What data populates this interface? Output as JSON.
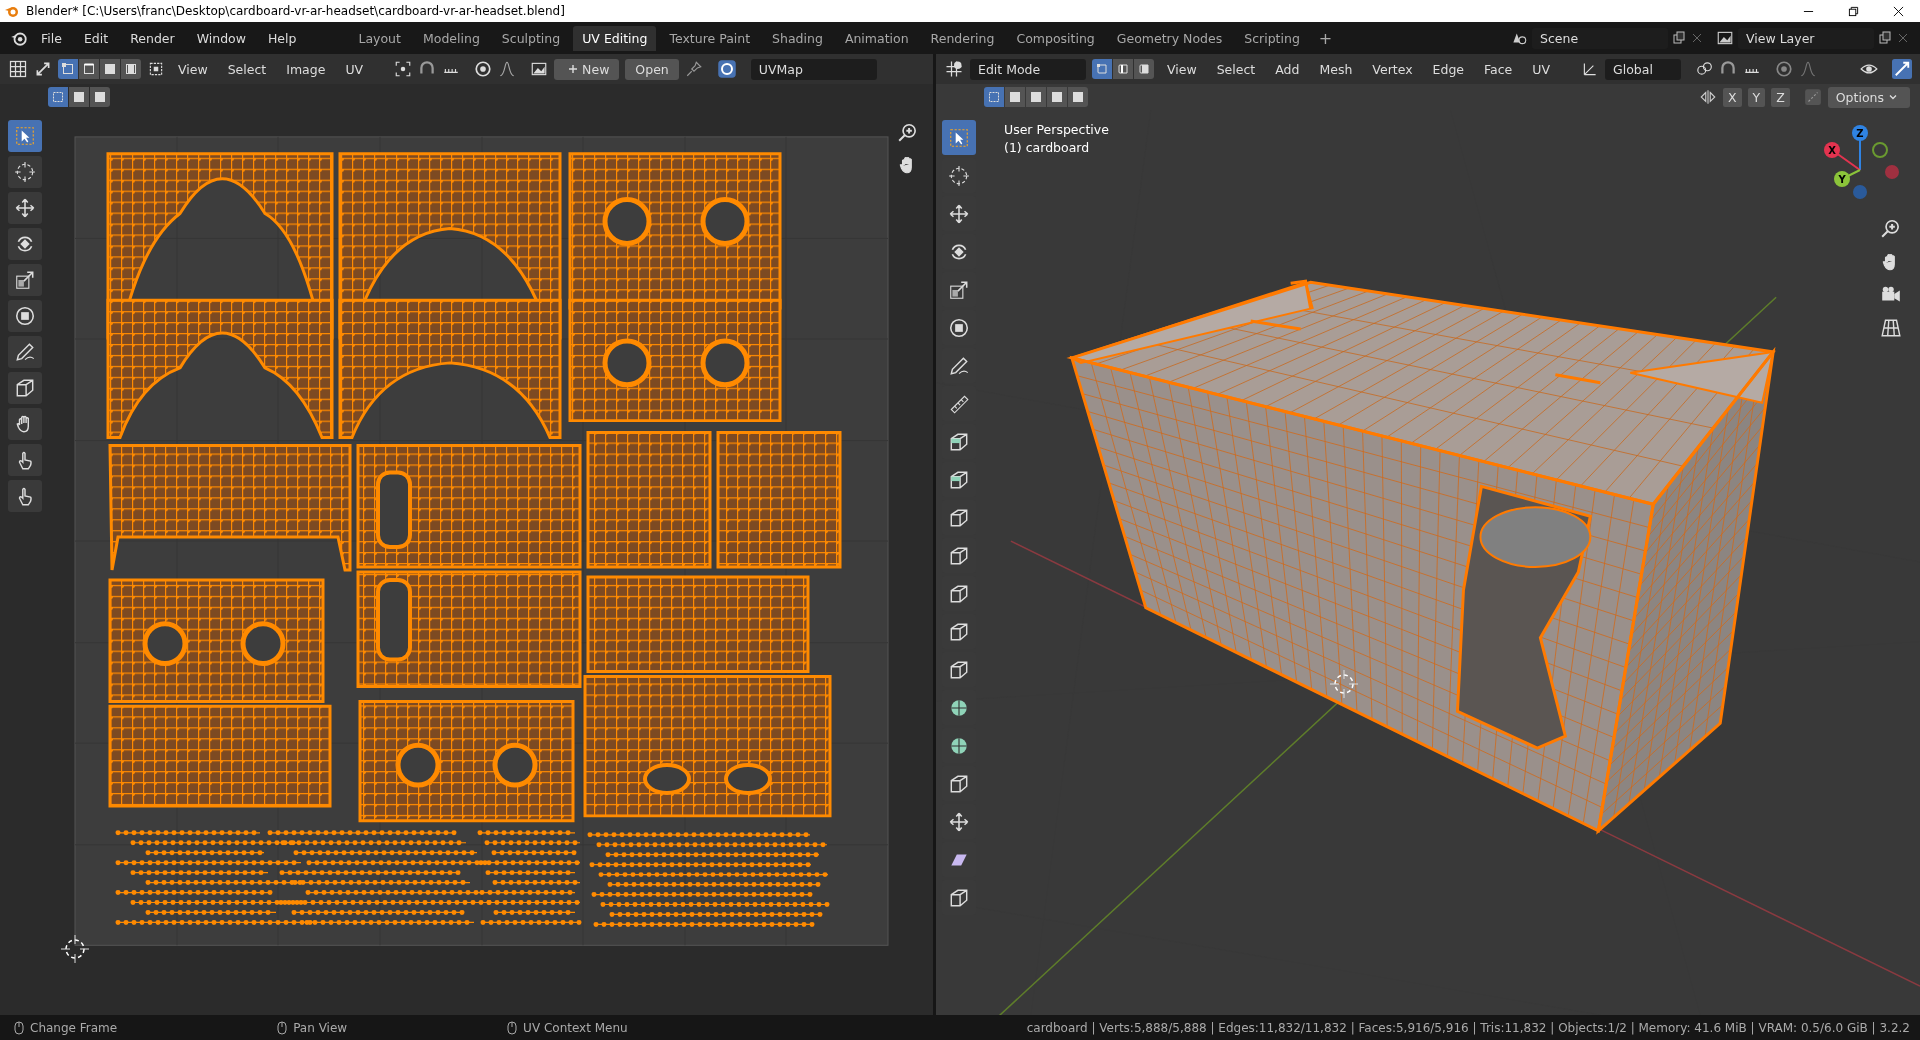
{
  "window": {
    "title": "Blender* [C:\\Users\\franc\\Desktop\\cardboard-vr-ar-headset\\cardboard-vr-ar-headset.blend]"
  },
  "menu": [
    "File",
    "Edit",
    "Render",
    "Window",
    "Help"
  ],
  "workspaces": [
    {
      "label": "Layout",
      "selected": false
    },
    {
      "label": "Modeling",
      "selected": false
    },
    {
      "label": "Sculpting",
      "selected": false
    },
    {
      "label": "UV Editing",
      "selected": true
    },
    {
      "label": "Texture Paint",
      "selected": false
    },
    {
      "label": "Shading",
      "selected": false
    },
    {
      "label": "Animation",
      "selected": false
    },
    {
      "label": "Rendering",
      "selected": false
    },
    {
      "label": "Compositing",
      "selected": false
    },
    {
      "label": "Geometry Nodes",
      "selected": false
    },
    {
      "label": "Scripting",
      "selected": false
    }
  ],
  "add_workspace": "+",
  "scene": {
    "value": "Scene"
  },
  "view_layer": {
    "value": "View Layer"
  },
  "uv_editor": {
    "select_modes": [
      {
        "selected": true
      },
      {
        "selected": false
      },
      {
        "selected": false
      },
      {
        "selected": false
      }
    ],
    "menus": [
      "View",
      "Select",
      "Image",
      "UV"
    ],
    "new_button": "New",
    "open_button": "Open",
    "uv_map": "UVMap",
    "box_modes": [
      {
        "selected": true
      },
      {
        "selected": false
      },
      {
        "selected": false
      }
    ],
    "tools": [
      {
        "kind": "select",
        "selected": true
      },
      {
        "kind": "cursor",
        "selected": false
      },
      {
        "kind": "move",
        "selected": false
      },
      {
        "kind": "rotate",
        "selected": false
      },
      {
        "kind": "scale",
        "selected": false
      },
      {
        "kind": "transform",
        "selected": false
      },
      {
        "kind": "annotate",
        "selected": false
      },
      {
        "kind": "rip",
        "selected": false
      },
      {
        "kind": "grab",
        "selected": false
      },
      {
        "kind": "relax",
        "selected": false
      },
      {
        "kind": "pinch",
        "selected": false
      }
    ]
  },
  "viewport": {
    "mode": "Edit Mode",
    "select_modes": [
      {
        "selected": true
      },
      {
        "selected": false
      },
      {
        "selected": false
      }
    ],
    "menus": [
      "View",
      "Select",
      "Add",
      "Mesh",
      "Vertex",
      "Edge",
      "Face",
      "UV"
    ],
    "orientation": "Global",
    "axes": [
      "X",
      "Y",
      "Z"
    ],
    "options": "Options",
    "box_modes": [
      {
        "selected": true
      },
      {
        "selected": false
      },
      {
        "selected": false
      },
      {
        "selected": false
      },
      {
        "selected": false
      }
    ],
    "overlay": [
      "User Perspective",
      "(1) cardboard"
    ],
    "gizmo": [
      {
        "label": "Z",
        "color": "#2f83e3"
      },
      {
        "label": "X",
        "color": "#e3334f"
      },
      {
        "label": "Y",
        "color": "#8bc43a"
      }
    ],
    "tools": [
      {
        "kind": "select",
        "selected": true
      },
      {
        "kind": "cursor",
        "selected": false
      },
      {
        "kind": "move",
        "selected": false
      },
      {
        "kind": "rotate",
        "selected": false
      },
      {
        "kind": "scale",
        "selected": false
      },
      {
        "kind": "transform",
        "selected": false
      },
      {
        "kind": "annotate",
        "selected": false
      },
      {
        "kind": "measure",
        "selected": false
      },
      {
        "kind": "cube",
        "selected": false
      },
      {
        "kind": "extrude",
        "selected": false
      },
      {
        "kind": "inset",
        "selected": false
      },
      {
        "kind": "bevel",
        "selected": false
      },
      {
        "kind": "loopcut",
        "selected": false
      },
      {
        "kind": "knife",
        "selected": false
      },
      {
        "kind": "polybuild",
        "selected": false
      },
      {
        "kind": "spin",
        "selected": false
      },
      {
        "kind": "smooth",
        "selected": false
      },
      {
        "kind": "slide",
        "selected": false
      },
      {
        "kind": "shrink",
        "selected": false
      },
      {
        "kind": "shear",
        "selected": false
      },
      {
        "kind": "rip",
        "selected": false
      }
    ]
  },
  "status_bar": {
    "hints": [
      "Change Frame",
      "Pan View",
      "UV Context Menu"
    ],
    "stats": "cardboard | Verts:5,888/5,888 | Edges:11,832/11,832 | Faces:5,916/5,916 | Tris:11,832 | Objects:1/2 | Memory: 41.6 MiB | VRAM: 0.5/6.0 GiB | 3.2.2"
  }
}
